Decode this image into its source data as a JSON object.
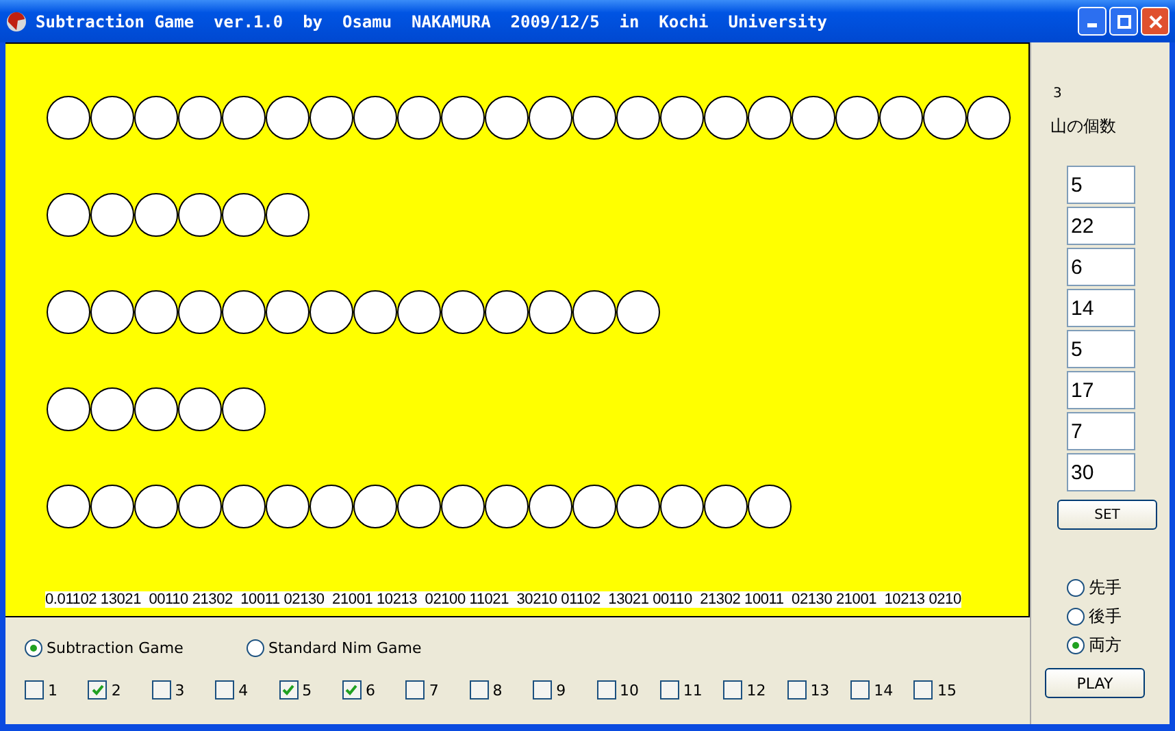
{
  "window": {
    "title": "Subtraction Game  ver.1.0  by  Osamu  NAKAMURA  2009/12/5  in  Kochi  University"
  },
  "piles": [
    {
      "stones": [
        {
          "kind": "stone"
        },
        {
          "kind": "stone"
        },
        {
          "kind": "stone"
        },
        {
          "kind": "stone"
        },
        {
          "kind": "stone"
        },
        {
          "kind": "stone"
        },
        {
          "kind": "stone"
        },
        {
          "kind": "stone"
        },
        {
          "kind": "stone"
        },
        {
          "kind": "stone"
        },
        {
          "kind": "stone"
        },
        {
          "kind": "stone"
        },
        {
          "kind": "stone"
        },
        {
          "kind": "stone"
        },
        {
          "kind": "stone"
        },
        {
          "kind": "stone"
        },
        {
          "kind": "stone"
        },
        {
          "kind": "stone"
        },
        {
          "kind": "stone"
        },
        {
          "kind": "stone"
        },
        {
          "kind": "stone"
        },
        {
          "kind": "stone"
        }
      ]
    },
    {
      "stones": [
        {
          "kind": "stone"
        },
        {
          "kind": "stone"
        },
        {
          "kind": "stone"
        },
        {
          "kind": "stone"
        },
        {
          "kind": "stone"
        },
        {
          "kind": "stone"
        }
      ]
    },
    {
      "stones": [
        {
          "kind": "stone"
        },
        {
          "kind": "stone"
        },
        {
          "kind": "stone"
        },
        {
          "kind": "stone"
        },
        {
          "kind": "stone"
        },
        {
          "kind": "stone"
        },
        {
          "kind": "stone"
        },
        {
          "kind": "stone"
        },
        {
          "kind": "stone"
        },
        {
          "kind": "stone"
        },
        {
          "kind": "stone"
        },
        {
          "kind": "stone"
        },
        {
          "kind": "stone"
        },
        {
          "kind": "stone"
        }
      ]
    },
    {
      "stones": [
        {
          "kind": "stone"
        },
        {
          "kind": "stone"
        },
        {
          "kind": "stone"
        },
        {
          "kind": "stone"
        },
        {
          "kind": "stone"
        }
      ]
    },
    {
      "stones": [
        {
          "kind": "stone"
        },
        {
          "kind": "stone"
        },
        {
          "kind": "stone"
        },
        {
          "kind": "stone"
        },
        {
          "kind": "stone"
        },
        {
          "kind": "stone"
        },
        {
          "kind": "stone"
        },
        {
          "kind": "stone"
        },
        {
          "kind": "stone"
        },
        {
          "kind": "stone"
        },
        {
          "kind": "stone"
        },
        {
          "kind": "stone"
        },
        {
          "kind": "stone"
        },
        {
          "kind": "stone"
        },
        {
          "kind": "stone"
        },
        {
          "kind": "stone"
        },
        {
          "kind": "stone"
        }
      ]
    }
  ],
  "sequence": "0.01102 13021  00110 21302  10011 02130  21001 10213  02100 11021  30210 01102  13021 00110  21302 10011  02130 21001  10213 0210",
  "side_panel": {
    "number": "3",
    "pile_count_label": "山の個数",
    "fields": [
      "5",
      "22",
      "6",
      "14",
      "5",
      "17",
      "7",
      "30"
    ],
    "set_button": "SET",
    "turn_options": [
      {
        "label": "先手",
        "selected": false
      },
      {
        "label": "後手",
        "selected": false
      },
      {
        "label": "両方",
        "selected": true
      }
    ],
    "play_button": "PLAY"
  },
  "game_modes": [
    {
      "label": "Subtraction Game",
      "selected": true
    },
    {
      "label": "Standard Nim Game",
      "selected": false
    }
  ],
  "moves": [
    {
      "label": "1",
      "checked": false
    },
    {
      "label": "2",
      "checked": true
    },
    {
      "label": "3",
      "checked": false
    },
    {
      "label": "4",
      "checked": false
    },
    {
      "label": "5",
      "checked": true
    },
    {
      "label": "6",
      "checked": true
    },
    {
      "label": "7",
      "checked": false
    },
    {
      "label": "8",
      "checked": false
    },
    {
      "label": "9",
      "checked": false
    },
    {
      "label": "10",
      "checked": false
    },
    {
      "label": "11",
      "checked": false
    },
    {
      "label": "12",
      "checked": false
    },
    {
      "label": "13",
      "checked": false
    },
    {
      "label": "14",
      "checked": false
    },
    {
      "label": "15",
      "checked": false
    }
  ]
}
